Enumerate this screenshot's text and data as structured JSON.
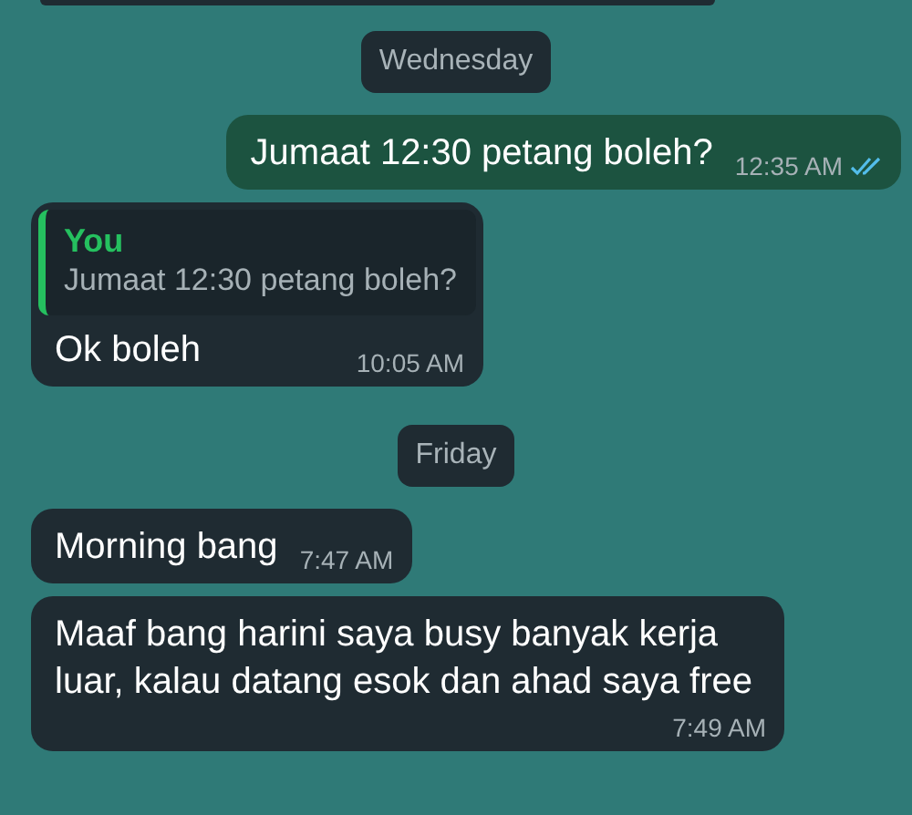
{
  "chat": [
    {
      "kind": "partial"
    },
    {
      "kind": "date",
      "label": "Wednesday"
    },
    {
      "kind": "outgoing",
      "text": "Jumaat 12:30 petang boleh?",
      "time": "12:35 AM",
      "read": true
    },
    {
      "kind": "incoming",
      "quote": {
        "author": "You",
        "text": "Jumaat 12:30 petang boleh?"
      },
      "text": "Ok boleh",
      "time": "10:05 AM"
    },
    {
      "kind": "date",
      "label": "Friday"
    },
    {
      "kind": "incoming",
      "text": "Morning bang",
      "time": "7:47 AM"
    },
    {
      "kind": "incoming",
      "text": "Maaf bang harini saya busy banyak kerja luar, kalau datang esok dan ahad saya free",
      "time": "7:49 AM"
    }
  ]
}
